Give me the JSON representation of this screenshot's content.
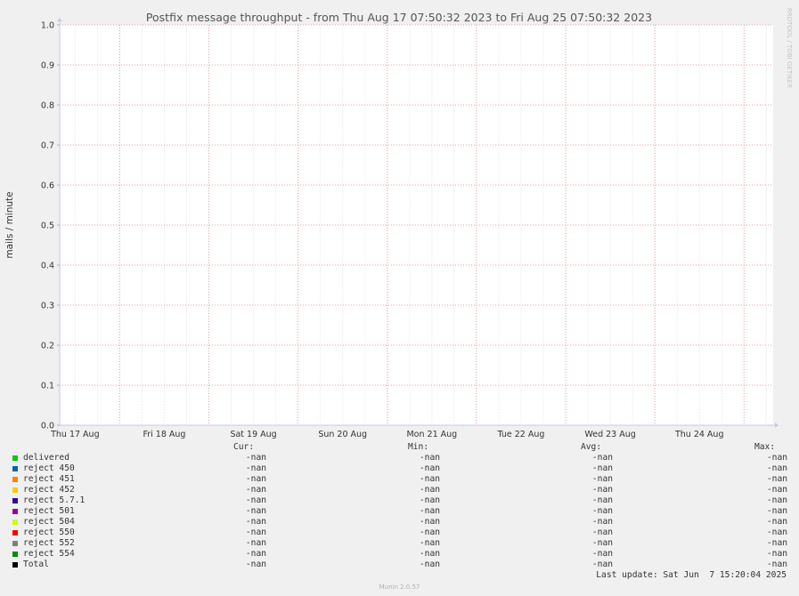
{
  "chart_data": {
    "type": "line",
    "title": "Postfix message throughput - from Thu Aug 17 07:50:32 2023 to Fri Aug 25 07:50:32 2023",
    "ylabel": "mails / minute",
    "xlabel": "",
    "ylim": [
      0,
      1
    ],
    "yticks": [
      "0.0",
      "0.1",
      "0.2",
      "0.3",
      "0.4",
      "0.5",
      "0.6",
      "0.7",
      "0.8",
      "0.9",
      "1.0"
    ],
    "xtick_labels": [
      "Thu 17 Aug",
      "Fri 18 Aug",
      "Sat 19 Aug",
      "Sun 20 Aug",
      "Mon 21 Aug",
      "Tue 22 Aug",
      "Wed 23 Aug",
      "Thu 24 Aug"
    ],
    "x_range": [
      "Thu Aug 17 07:50:32 2023",
      "Fri Aug 25 07:50:32 2023"
    ],
    "grid": true,
    "series": [
      {
        "name": "delivered",
        "color": "#00cc00",
        "cur": "-nan",
        "min": "-nan",
        "avg": "-nan",
        "max": "-nan",
        "values": []
      },
      {
        "name": "reject 450",
        "color": "#0066b3",
        "cur": "-nan",
        "min": "-nan",
        "avg": "-nan",
        "max": "-nan",
        "values": []
      },
      {
        "name": "reject 451",
        "color": "#ff8000",
        "cur": "-nan",
        "min": "-nan",
        "avg": "-nan",
        "max": "-nan",
        "values": []
      },
      {
        "name": "reject 452",
        "color": "#ffcc00",
        "cur": "-nan",
        "min": "-nan",
        "avg": "-nan",
        "max": "-nan",
        "values": []
      },
      {
        "name": "reject 5.7.1",
        "color": "#330099",
        "cur": "-nan",
        "min": "-nan",
        "avg": "-nan",
        "max": "-nan",
        "values": []
      },
      {
        "name": "reject 501",
        "color": "#990099",
        "cur": "-nan",
        "min": "-nan",
        "avg": "-nan",
        "max": "-nan",
        "values": []
      },
      {
        "name": "reject 504",
        "color": "#ccff00",
        "cur": "-nan",
        "min": "-nan",
        "avg": "-nan",
        "max": "-nan",
        "values": []
      },
      {
        "name": "reject 550",
        "color": "#ff0000",
        "cur": "-nan",
        "min": "-nan",
        "avg": "-nan",
        "max": "-nan",
        "values": []
      },
      {
        "name": "reject 552",
        "color": "#808080",
        "cur": "-nan",
        "min": "-nan",
        "avg": "-nan",
        "max": "-nan",
        "values": []
      },
      {
        "name": "reject 554",
        "color": "#008f00",
        "cur": "-nan",
        "min": "-nan",
        "avg": "-nan",
        "max": "-nan",
        "values": []
      },
      {
        "name": "Total",
        "color": "#000000",
        "cur": "-nan",
        "min": "-nan",
        "avg": "-nan",
        "max": "-nan",
        "values": []
      }
    ]
  },
  "legend_headers": {
    "cur": "Cur:",
    "min": "Min:",
    "avg": "Avg:",
    "max": "Max:"
  },
  "last_update": "Last update: Sat Jun  7 15:20:04 2025",
  "watermark": "RRDTOOL / TOBI OETIKER",
  "version": "Munin 2.0.57"
}
